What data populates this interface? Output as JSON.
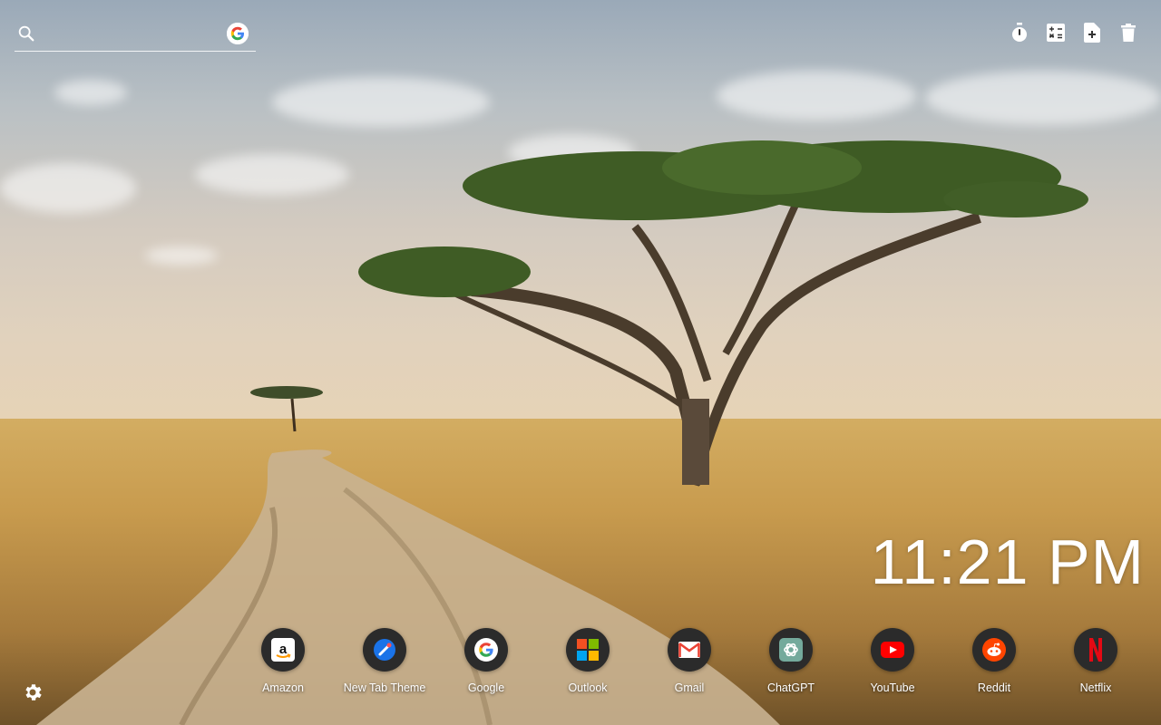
{
  "search": {
    "placeholder": "",
    "icon": "search-icon",
    "engine_icon": "google-icon"
  },
  "toolbar": {
    "items": [
      {
        "name": "timer",
        "icon": "stopwatch-icon"
      },
      {
        "name": "calculator",
        "icon": "calculator-icon"
      },
      {
        "name": "notes",
        "icon": "add-note-icon"
      },
      {
        "name": "trash",
        "icon": "trash-icon"
      }
    ]
  },
  "clock": {
    "time": "11:21 PM"
  },
  "shortcuts": [
    {
      "label": "Amazon",
      "icon": "amazon-icon"
    },
    {
      "label": "New Tab Theme",
      "icon": "new-tab-theme-icon"
    },
    {
      "label": "Google",
      "icon": "google-icon"
    },
    {
      "label": "Outlook",
      "icon": "outlook-icon"
    },
    {
      "label": "Gmail",
      "icon": "gmail-icon"
    },
    {
      "label": "ChatGPT",
      "icon": "chatgpt-icon"
    },
    {
      "label": "YouTube",
      "icon": "youtube-icon"
    },
    {
      "label": "Reddit",
      "icon": "reddit-icon"
    },
    {
      "label": "Netflix",
      "icon": "netflix-icon"
    }
  ],
  "settings": {
    "icon": "gear-icon"
  },
  "colors": {
    "text": "#ffffff",
    "shortcut_bg": "#2b2b2b"
  }
}
